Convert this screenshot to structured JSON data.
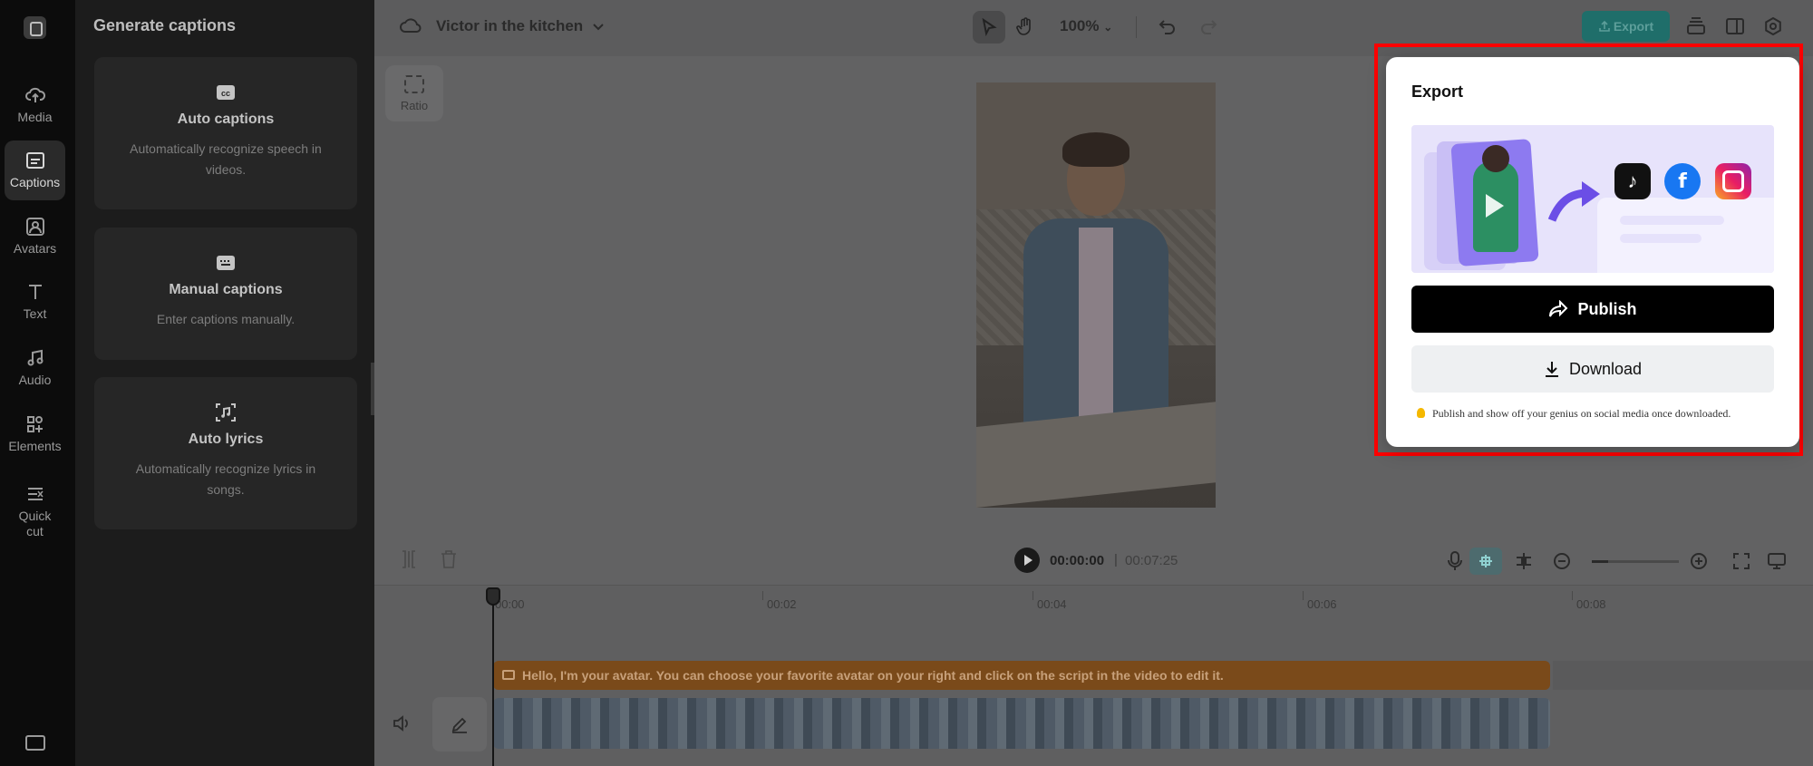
{
  "rail": {
    "items": [
      {
        "label": "Media",
        "icon": "cloud-upload-icon"
      },
      {
        "label": "Captions",
        "icon": "captions-icon"
      },
      {
        "label": "Avatars",
        "icon": "avatar-icon"
      },
      {
        "label": "Text",
        "icon": "text-icon"
      },
      {
        "label": "Audio",
        "icon": "music-note-icon"
      },
      {
        "label": "Elements",
        "icon": "elements-icon"
      },
      {
        "label": "Quick\ncut",
        "icon": "quick-cut-icon"
      }
    ],
    "active": "Captions"
  },
  "panel": {
    "title": "Generate captions",
    "cards": [
      {
        "title": "Auto captions",
        "desc": "Automatically recognize speech in videos.",
        "icon": "cc-icon"
      },
      {
        "title": "Manual captions",
        "desc": "Enter captions manually.",
        "icon": "keyboard-icon"
      },
      {
        "title": "Auto lyrics",
        "desc": "Automatically recognize lyrics in songs.",
        "icon": "scan-music-icon"
      }
    ]
  },
  "header": {
    "project_title": "Victor in the kitchen",
    "zoom": "100%",
    "export_label": "Export"
  },
  "canvas": {
    "ratio_label": "Ratio"
  },
  "timeline": {
    "current_time": "00:00:00",
    "separator": "|",
    "total_time": "00:07:25",
    "ruler": [
      "00:00",
      "00:02",
      "00:04",
      "00:06",
      "00:08"
    ],
    "caption_text": "Hello, I'm your avatar. You can choose your favorite avatar on your right and click on the script in the video to edit it."
  },
  "export_dialog": {
    "title": "Export",
    "publish_label": "Publish",
    "download_label": "Download",
    "tip": "Publish and show off your genius on social media once downloaded.",
    "socials": [
      "tiktok-icon",
      "facebook-icon",
      "instagram-icon"
    ]
  },
  "colors": {
    "accent": "#1f6e6a",
    "highlight_frame": "#ff0000",
    "caption_track": "#7a4a1a"
  }
}
